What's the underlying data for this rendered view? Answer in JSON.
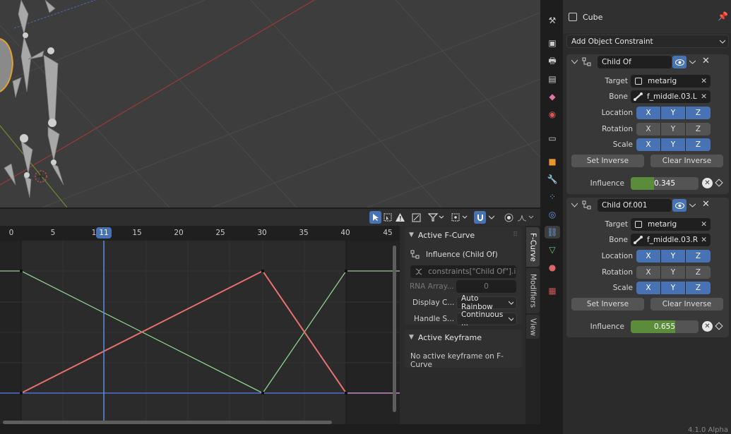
{
  "viewport": {},
  "graph_toolbar": {},
  "timeline": {
    "ticks": [
      "0",
      "5",
      "1",
      "15",
      "20",
      "25",
      "30",
      "35",
      "40",
      "45"
    ],
    "current_frame": "11"
  },
  "npanel": {
    "active_fcurve": {
      "title": "Active F-Curve",
      "channel_name": "Influence (Child Of)",
      "data_path": "constraints[\"Child Of\"].i...",
      "rna_array_label": "RNA Array...",
      "rna_array_value": "0",
      "display_color_label": "Display C...",
      "display_color_value": "Auto Rainbow",
      "handle_smoothing_label": "Handle S...",
      "handle_smoothing_value": "Continuous ..."
    },
    "active_keyframe": {
      "title": "Active Keyframe",
      "message": "No active keyframe on F-Curve"
    }
  },
  "vtabs": {
    "fcurve": "F-Curve",
    "modifiers": "Modifiers",
    "view": "View"
  },
  "properties": {
    "object_name": "Cube",
    "add_constraint": "Add Object Constraint",
    "constraints": [
      {
        "name": "Child Of",
        "target_label": "Target",
        "target_value": "metarig",
        "bone_label": "Bone",
        "bone_value": "f_middle.03.L",
        "location_label": "Location",
        "rotation_label": "Rotation",
        "scale_label": "Scale",
        "x": "X",
        "y": "Y",
        "z": "Z",
        "set_inverse": "Set Inverse",
        "clear_inverse": "Clear Inverse",
        "influence_label": "Influence",
        "influence_value": "0.345",
        "influence": 0.345
      },
      {
        "name": "Child Of.001",
        "target_label": "Target",
        "target_value": "metarig",
        "bone_label": "Bone",
        "bone_value": "f_middle.03.R",
        "location_label": "Location",
        "rotation_label": "Rotation",
        "scale_label": "Scale",
        "x": "X",
        "y": "Y",
        "z": "Z",
        "set_inverse": "Set Inverse",
        "clear_inverse": "Clear Inverse",
        "influence_label": "Influence",
        "influence_value": "0.655",
        "influence": 0.655
      }
    ]
  },
  "status": {
    "version": "4.1.0 Alpha"
  },
  "colors": {
    "accent": "#4772b3",
    "influence_fill": "#5b8c3a",
    "curve_red": "#e8716b",
    "curve_green": "#8fd18f",
    "curve_blue": "#4d6fd1"
  }
}
